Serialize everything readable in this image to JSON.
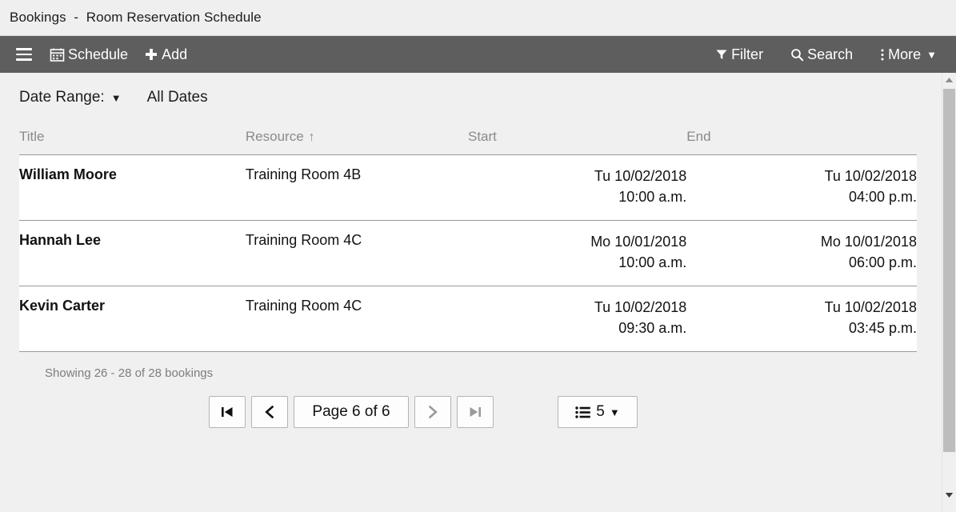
{
  "window": {
    "title": "Bookings  -  Room Reservation Schedule"
  },
  "toolbar": {
    "menu_icon": "hamburger-menu-icon",
    "schedule_label": "Schedule",
    "schedule_icon": "calendar-icon",
    "add_label": "Add",
    "add_icon": "plus-icon",
    "filter_label": "Filter",
    "filter_icon": "funnel-icon",
    "search_label": "Search",
    "search_icon": "magnifier-icon",
    "more_label": "More",
    "more_icon": "kebab-menu-icon",
    "more_caret": "▼",
    "background_color": "#5e5e5e",
    "text_color": "#ffffff"
  },
  "filters": {
    "date_range_label": "Date Range:",
    "date_range_caret": "▼",
    "date_range_value": "All Dates"
  },
  "table": {
    "columns": [
      {
        "key": "title",
        "label": "Title",
        "sorted": false,
        "sort_arrow": ""
      },
      {
        "key": "resource",
        "label": "Resource",
        "sorted": true,
        "sort_arrow": "↑"
      },
      {
        "key": "start",
        "label": "Start",
        "sorted": false,
        "sort_arrow": ""
      },
      {
        "key": "end",
        "label": "End",
        "sorted": false,
        "sort_arrow": ""
      }
    ],
    "rows": [
      {
        "title": "William Moore",
        "resource": "Training Room 4B",
        "start": "Tu 10/02/2018\n10:00 a.m.",
        "end": "Tu 10/02/2018\n04:00 p.m."
      },
      {
        "title": "Hannah Lee",
        "resource": "Training Room 4C",
        "start": "Mo 10/01/2018\n10:00 a.m.",
        "end": "Mo 10/01/2018\n06:00 p.m."
      },
      {
        "title": "Kevin Carter",
        "resource": "Training Room 4C",
        "start": "Tu 10/02/2018\n09:30 a.m.",
        "end": "Tu 10/02/2018\n03:45 p.m."
      }
    ]
  },
  "footer": {
    "showing_text": "Showing 26 - 28 of 28 bookings",
    "page_label": "Page 6 of 6",
    "page_size": "5",
    "page_size_caret": "▼",
    "first_icon": "first-page-icon",
    "prev_icon": "previous-page-icon",
    "next_icon": "next-page-icon",
    "last_icon": "last-page-icon",
    "page_size_icon": "list-icon",
    "first_enabled": true,
    "prev_enabled": true,
    "next_enabled": false,
    "last_enabled": false,
    "disabled_color": "#9a9a9a",
    "enabled_color": "#111111"
  }
}
